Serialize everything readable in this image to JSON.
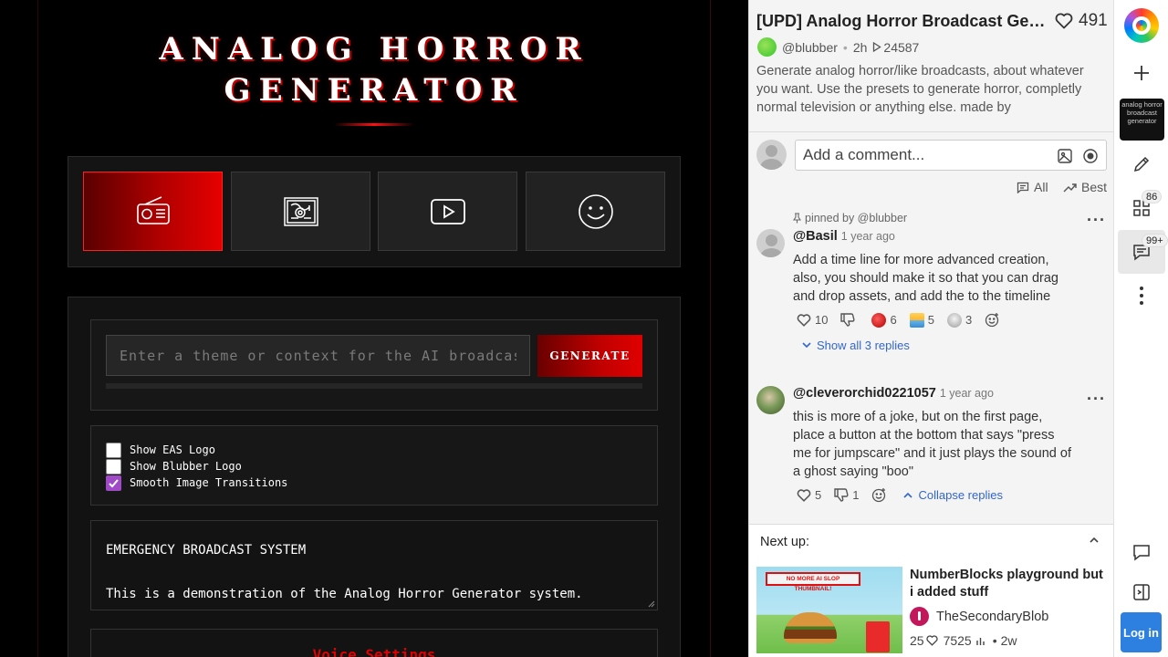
{
  "app": {
    "title_line1": "ANALOG HORROR",
    "title_line2": "GENERATOR",
    "theme_input_placeholder": "Enter a theme or context for the AI broadcast...",
    "generate_label": "GENERATE",
    "checkboxes": [
      {
        "label": "Show EAS Logo",
        "checked": false
      },
      {
        "label": "Show Blubber Logo",
        "checked": false
      },
      {
        "label": "Smooth Image Transitions",
        "checked": true
      }
    ],
    "broadcast_line1": "EMERGENCY BROADCAST SYSTEM",
    "broadcast_line2": "This is a demonstration of the Analog Horror Generator system.",
    "voice_settings_label": "Voice Settings"
  },
  "post": {
    "title": "[UPD] Analog Horror Broadcast Generator",
    "likes": "491",
    "author": "@blubber",
    "age": "2h",
    "plays": "24587",
    "description": "Generate analog horror/like broadcasts, about whatever you want. Use the presets to generate horror, completly normal television or anything else. made by"
  },
  "comments_ui": {
    "input_placeholder": "Add a comment...",
    "sort_all": "All",
    "sort_best": "Best"
  },
  "comments": [
    {
      "pinned_by": "pinned by @blubber",
      "user": "@Basil",
      "time": "1 year ago",
      "body": "Add a time line for more advanced creation, also, you should make it so that you can drag and drop assets, and add the to the timeline",
      "likes": "10",
      "reactions": [
        "6",
        "5",
        "3"
      ],
      "replies_link": "Show all 3 replies"
    },
    {
      "user": "@cleverorchid0221057",
      "time": "1 year ago",
      "body": "this is more of a joke, but on the first page, place a button at the bottom that says \"press me for jumpscare\" and it just plays the sound of a ghost saying \"boo\"",
      "likes": "5",
      "dislikes": "1",
      "collapse_link": "Collapse replies"
    }
  ],
  "next_up": {
    "label": "Next up:",
    "thumb_banner": "NO MORE AI SLOP THUMBNAIL!",
    "title": "NumberBlocks playground but i added stuff",
    "author": "TheSecondaryBlob",
    "likes": "25",
    "plays": "7525",
    "age": "2w"
  },
  "rail": {
    "thumb_text": "analog horror broadcast generator",
    "remix_count": "86",
    "comment_count": "99+",
    "login_label": "Log in"
  }
}
